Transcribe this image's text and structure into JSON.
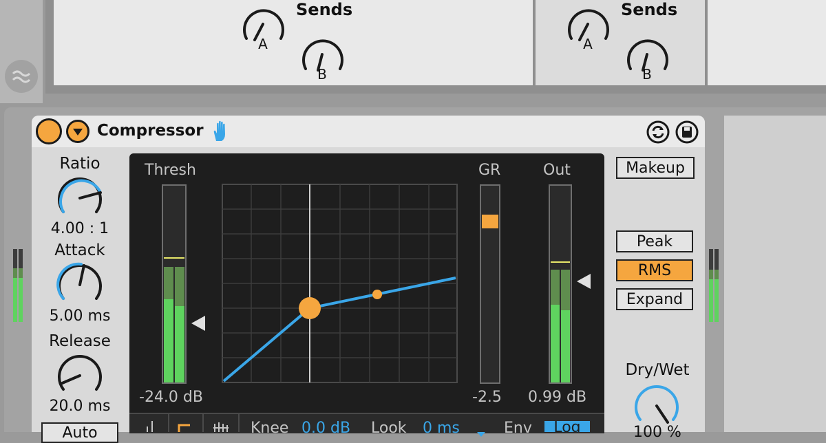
{
  "sends": [
    {
      "title": "Sends",
      "knob_a": "A",
      "knob_b": "B"
    },
    {
      "title": "Sends",
      "knob_a": "A",
      "knob_b": "B"
    }
  ],
  "device": {
    "title": "Compressor",
    "icons": {
      "power": "power-icon",
      "menu": "dropdown-arrow-icon",
      "hand": "hand-icon",
      "hot_swap": "hot-swap-icon",
      "save": "save-icon",
      "eq": "eq-waveform-icon"
    },
    "colors": {
      "accent": "#f5a63f",
      "blue": "#3aa6e8",
      "meter_green": "#5fd35f"
    },
    "params": {
      "ratio": {
        "label": "Ratio",
        "value": "4.00 : 1"
      },
      "attack": {
        "label": "Attack",
        "value": "5.00 ms"
      },
      "release": {
        "label": "Release",
        "value": "20.0 ms"
      },
      "auto": "Auto"
    },
    "display": {
      "thresh_label": "Thresh",
      "gr_label": "GR",
      "out_label": "Out",
      "thresh_value": "-24.0 dB",
      "gr_value": "-2.5",
      "out_value": "0.99 dB"
    },
    "buttons": {
      "makeup": "Makeup",
      "peak": "Peak",
      "rms": "RMS",
      "expand": "Expand",
      "active_mode": "RMS"
    },
    "dry_wet": {
      "label": "Dry/Wet",
      "value": "100 %"
    },
    "bottom_bar": {
      "knee_label": "Knee",
      "knee_value": "0.0 dB",
      "look_label": "Look",
      "look_value": "0 ms",
      "env_label": "Env",
      "log_label": "Log"
    }
  }
}
